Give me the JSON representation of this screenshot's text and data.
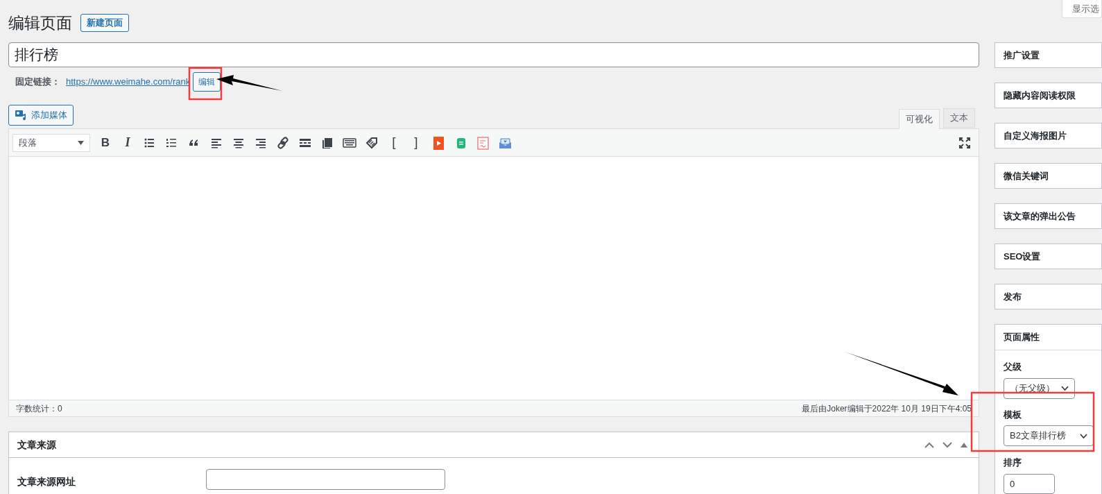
{
  "header": {
    "title": "编辑页面",
    "new_button": "新建页面"
  },
  "screen_options": "显示选",
  "post_title": "排行榜",
  "permalink": {
    "label": "固定链接：",
    "url": "https://www.weimahe.com/rank",
    "edit_button": "编辑"
  },
  "add_media": "添加媒体",
  "editor_tabs": [
    {
      "label": "可视化",
      "selected": true
    },
    {
      "label": "文本",
      "selected": false
    }
  ],
  "format_select": "段落",
  "toolbar_buttons": [
    {
      "kind": "bold",
      "glyph": "B"
    },
    {
      "kind": "italic",
      "glyph": "I"
    },
    {
      "kind": "bullet-list"
    },
    {
      "kind": "number-list"
    },
    {
      "kind": "quote"
    },
    {
      "kind": "align-left"
    },
    {
      "kind": "align-center"
    },
    {
      "kind": "align-right"
    },
    {
      "kind": "link"
    },
    {
      "kind": "more"
    },
    {
      "kind": "pages"
    },
    {
      "kind": "keyboard"
    },
    {
      "kind": "tag"
    },
    {
      "kind": "text",
      "glyph": "["
    },
    {
      "kind": "text",
      "glyph": "]"
    },
    {
      "kind": "video"
    },
    {
      "kind": "sheet"
    },
    {
      "kind": "doc"
    },
    {
      "kind": "mail"
    }
  ],
  "word_count": "字数统计：0",
  "last_edited": "最后由Joker编辑于2022年 10月 19日下午4:05",
  "metabox": {
    "title": "文章来源",
    "field_label": "文章来源网址"
  },
  "sidebar": {
    "boxes": [
      "推广设置",
      "隐藏内容阅读权限",
      "自定义海报图片",
      "微信关键词",
      "该文章的弹出公告",
      "SEO设置",
      "发布"
    ],
    "page_attributes": {
      "title": "页面属性",
      "parent_label": "父级",
      "parent_value": "（无父级）",
      "template_label": "模板",
      "template_value": "B2文章排行榜",
      "order_label": "排序",
      "order_value": "0"
    }
  }
}
